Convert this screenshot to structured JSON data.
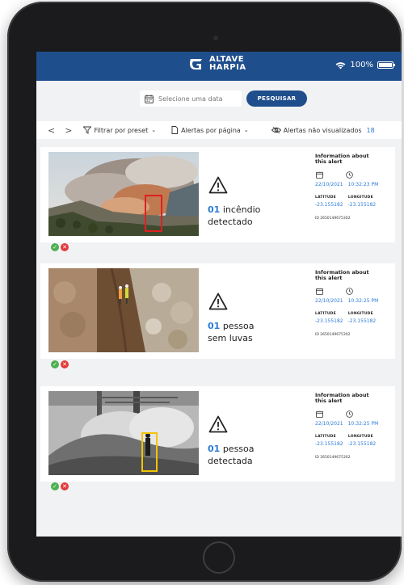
{
  "header": {
    "logo_line1": "ALTAVE",
    "logo_line2": "HARPIA",
    "battery_text": "100%"
  },
  "search": {
    "placeholder": "Selecione uma data",
    "button_label": "PESQUISAR"
  },
  "toolbar": {
    "prev": "<",
    "next": ">",
    "filter_label": "Filtrar por preset",
    "per_page_label": "Alertas por página",
    "unseen_label": "Alertas não visualizados",
    "unseen_count": "18"
  },
  "alerts": [
    {
      "count": "01",
      "line1": "incêndio",
      "line2": "detectado",
      "info_title": "Information about this alert",
      "date": "22/10/2021",
      "time": "10:32:23 PM",
      "lat_label": "LATITUDE",
      "lon_label": "LONGITUDE",
      "lat": "-23.155182",
      "lon": "-23.155182",
      "id": "ID 2650149675302"
    },
    {
      "count": "01",
      "line1": "pessoa",
      "line2": "sem luvas",
      "info_title": "Information about this alert",
      "date": "22/10/2021",
      "time": "10:32:25 PM",
      "lat_label": "LATITUDE",
      "lon_label": "LONGITUDE",
      "lat": "-23.155182",
      "lon": "-23.155182",
      "id": "ID 2650149675302"
    },
    {
      "count": "01",
      "line1": "pessoa",
      "line2": "detectada",
      "info_title": "Information about this alert",
      "date": "22/10/2021",
      "time": "10:32:25 PM",
      "lat_label": "LATITUDE",
      "lon_label": "LONGITUDE",
      "lat": "-23.155182",
      "lon": "-23.155182",
      "id": "ID 2650149675302"
    }
  ],
  "icons": {
    "logo": "harpia-logo-icon",
    "wifi": "wifi-icon",
    "battery": "battery-icon",
    "calendar": "calendar-icon",
    "filter": "filter-icon",
    "page": "document-icon",
    "eye": "eye-icon",
    "warning": "warning-triangle-icon",
    "clock": "clock-icon",
    "approve": "check-icon",
    "reject": "close-icon"
  },
  "colors": {
    "brand_blue": "#1f4e8c",
    "accent_blue": "#2b7bd6",
    "approve_green": "#4cb050",
    "reject_red": "#e23b3b",
    "detection_box_red": "#e02020",
    "detection_box_yellow": "#f2c500"
  }
}
